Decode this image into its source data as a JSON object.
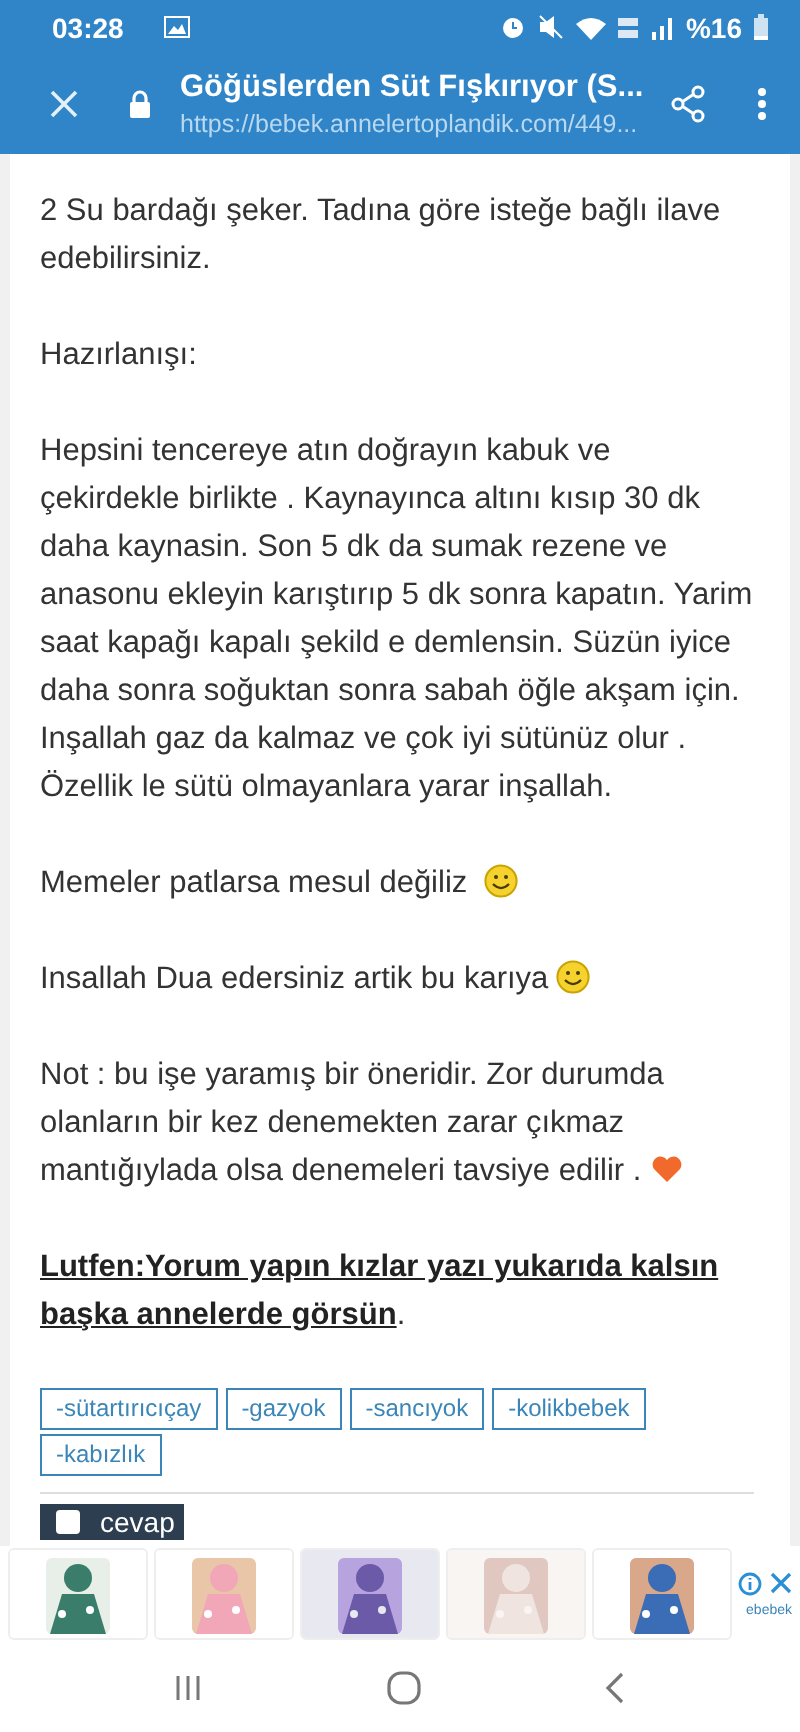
{
  "status_bar": {
    "time": "03:28",
    "battery": "%16"
  },
  "toolbar": {
    "title": "Göğüslerden Süt Fışkırıyor (S...",
    "url": "https://bebek.annelertoplandik.com/449..."
  },
  "paragraphs": [
    {
      "kind": "text",
      "text": "2 Su bardağı şeker.  Tadına göre isteğe bağlı ilave edebilirsiniz."
    },
    {
      "kind": "text",
      "text": "Hazırlanışı:"
    },
    {
      "kind": "text",
      "text": "Hepsini tencereye atın doğrayın kabuk ve çekirdekle birlikte . Kaynayınca altını kısıp 30 dk daha kaynasin. Son 5 dk da sumak rezene ve anasonu ekleyin karıştırıp 5 dk sonra kapatın.  Yarim saat kapağı kapalı şekild e demlensin.  Süzün iyice daha sonra soğuktan sonra sabah öğle akşam için.  Inşallah gaz da kalmaz ve çok iyi sütünüz olur . Özellik le sütü olmayanlara yarar inşallah."
    },
    {
      "kind": "smiley",
      "text": "Memeler patlarsa mesul değiliz "
    },
    {
      "kind": "smiley",
      "text": "Insallah Dua edersiniz artik bu karıya"
    },
    {
      "kind": "heart",
      "text": "Not : bu işe yaramış bir öneridir.  Zor durumda olanların bir kez denemekten zarar çıkmaz mantığıylada olsa denemeleri tavsiye edilir ."
    },
    {
      "kind": "text",
      "text": "**Lutfen:Yorum yapın kızlar yazı yukarıda kalsın başka annelerde görsün**."
    }
  ],
  "tags": [
    "-sütartırıcıçay",
    "-gazyok",
    "-sancıyok",
    "-kolikbebek",
    "-kabızlık"
  ],
  "reply_button": {
    "label": "cevap"
  },
  "ad": {
    "brand": "ebebek"
  }
}
